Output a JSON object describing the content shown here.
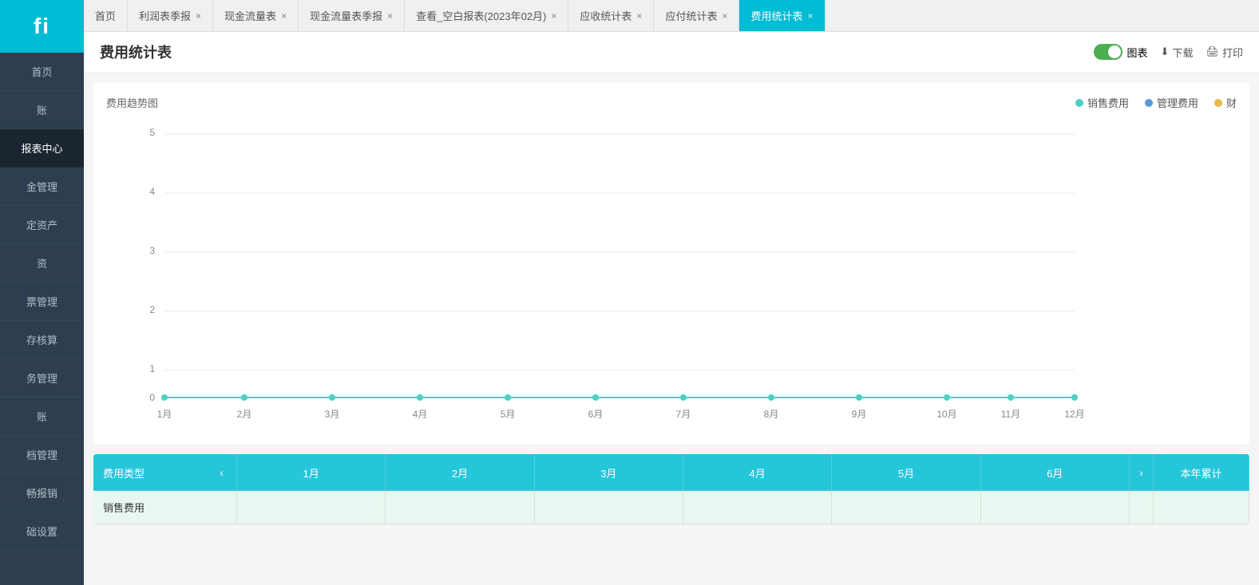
{
  "sidebar": {
    "logo": "fi",
    "items": [
      {
        "id": "home",
        "label": "首页"
      },
      {
        "id": "account",
        "label": "账"
      },
      {
        "id": "report-center",
        "label": "报表中心",
        "active": true
      },
      {
        "id": "fund-management",
        "label": "金管理"
      },
      {
        "id": "fixed-assets",
        "label": "定资产"
      },
      {
        "id": "investment",
        "label": "资"
      },
      {
        "id": "ticket-management",
        "label": "票管理"
      },
      {
        "id": "inventory",
        "label": "存核算"
      },
      {
        "id": "service-management",
        "label": "务管理"
      },
      {
        "id": "sub-account",
        "label": "账"
      },
      {
        "id": "archive-management",
        "label": "档管理"
      },
      {
        "id": "clearance",
        "label": "畅报销"
      },
      {
        "id": "basic-settings",
        "label": "础设置"
      }
    ]
  },
  "tabs": [
    {
      "id": "home",
      "label": "首页",
      "closable": false
    },
    {
      "id": "profit-quarterly",
      "label": "利润表季报",
      "closable": true
    },
    {
      "id": "cash-flow",
      "label": "现金流量表",
      "closable": true
    },
    {
      "id": "cash-flow-quarterly",
      "label": "现金流量表季报",
      "closable": true
    },
    {
      "id": "blank-report",
      "label": "查看_空白报表(2023年02月)",
      "closable": true
    },
    {
      "id": "receivable",
      "label": "应收统计表",
      "closable": true
    },
    {
      "id": "payable",
      "label": "应付统计表",
      "closable": true
    },
    {
      "id": "expense-stats",
      "label": "费用统计表",
      "closable": true,
      "active": true
    }
  ],
  "page": {
    "title": "费用统计表",
    "actions": {
      "chart_toggle_label": "图表",
      "download_label": "下载",
      "print_label": "打印"
    }
  },
  "chart": {
    "title": "费用趋势图",
    "legend": [
      {
        "id": "sales",
        "label": "销售费用",
        "color": "#4dd0c4"
      },
      {
        "id": "management",
        "label": "管理费用",
        "color": "#5b9bd5"
      },
      {
        "id": "finance",
        "label": "财",
        "color": "#e6b84d"
      }
    ],
    "y_axis": [
      5,
      4,
      3,
      2,
      1,
      0
    ],
    "x_axis": [
      "1月",
      "2月",
      "3月",
      "4月",
      "5月",
      "6月",
      "7月",
      "8月",
      "9月",
      "10月",
      "11月",
      "12月"
    ]
  },
  "table": {
    "header": {
      "type_col": "费用类型",
      "months": [
        "1月",
        "2月",
        "3月",
        "4月",
        "5月",
        "6月"
      ],
      "total_col": "本年累计",
      "nav_prev": "‹",
      "nav_next": "›"
    },
    "rows": [
      {
        "type": "销售费用",
        "values": [
          "",
          "",
          "",
          "",
          "",
          ""
        ],
        "total": ""
      }
    ]
  }
}
